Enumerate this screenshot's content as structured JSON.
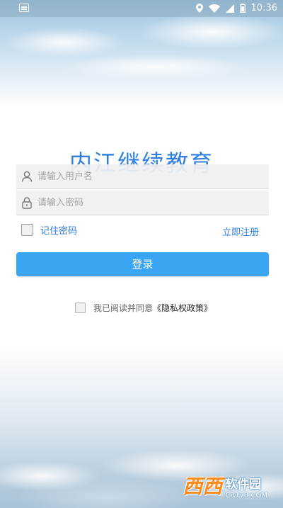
{
  "status_bar": {
    "time": "10:36",
    "icons": [
      "notification-icon",
      "location-icon",
      "wifi-icon",
      "signal-icon",
      "battery-icon"
    ]
  },
  "app": {
    "title": "内江继续教育"
  },
  "login_form": {
    "username_placeholder": "请输入用户名",
    "username_icon": "user-icon",
    "password_placeholder": "请输入密码",
    "password_icon": "lock-icon",
    "remember_label": "记住密码",
    "remember_checked": false,
    "register_label": "立即注册",
    "login_label": "登录"
  },
  "agreement": {
    "checked": false,
    "prefix": "我已阅读并同意",
    "policy_link": "《隐私权政策》"
  },
  "watermark": {
    "logo": "西西",
    "name": "软件园",
    "url": "CR173.COM"
  },
  "colors": {
    "accent": "#2f7fe0",
    "button": "#3aa6f3",
    "watermark_logo": "#ff8a1c"
  }
}
